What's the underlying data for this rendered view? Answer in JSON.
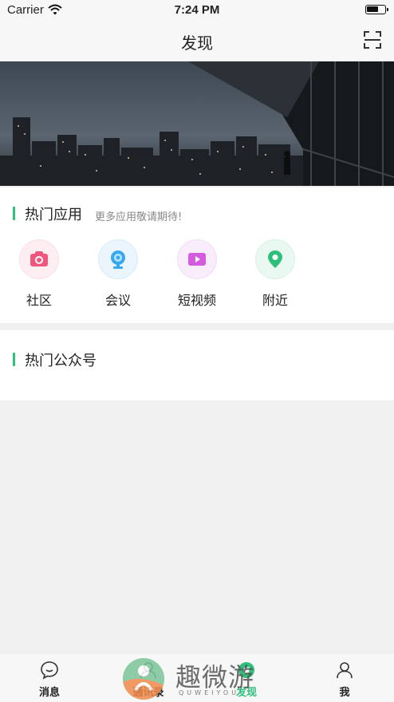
{
  "status_bar": {
    "carrier": "Carrier",
    "time": "7:24 PM"
  },
  "nav": {
    "title": "发现"
  },
  "hot_apps": {
    "title": "热门应用",
    "subtitle": "更多应用敬请期待!",
    "items": [
      {
        "label": "社区",
        "icon": "camera-icon",
        "color": "#f0567e"
      },
      {
        "label": "会议",
        "icon": "webcam-icon",
        "color": "#36a9f0"
      },
      {
        "label": "短视频",
        "icon": "video-icon",
        "color": "#d45ae0"
      },
      {
        "label": "附近",
        "icon": "location-pin-icon",
        "color": "#2ec07a"
      }
    ]
  },
  "public_accounts": {
    "title": "热门公众号"
  },
  "tab_bar": {
    "items": [
      {
        "label": "消息",
        "icon": "chat-bubble-icon"
      },
      {
        "label": "通讯录",
        "icon": "contacts-icon"
      },
      {
        "label": "发现",
        "icon": "discover-icon",
        "active": true
      },
      {
        "label": "我",
        "icon": "person-icon"
      }
    ]
  },
  "watermark": {
    "text": "趣微游",
    "subtext": "QUWEIYOU"
  },
  "colors": {
    "accent": "#2ec07a",
    "background": "#f0f0f0"
  }
}
